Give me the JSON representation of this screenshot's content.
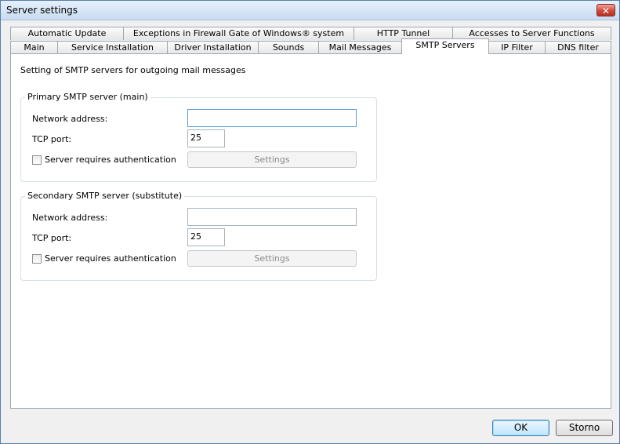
{
  "window": {
    "title": "Server settings",
    "close_glyph": "✕"
  },
  "tabs_row1": [
    {
      "label": "Automatic Update"
    },
    {
      "label": "Exceptions in Firewall Gate of Windows® system"
    },
    {
      "label": "HTTP Tunnel"
    },
    {
      "label": "Accesses to Server Functions"
    }
  ],
  "tabs_row2": [
    {
      "label": "Main"
    },
    {
      "label": "Service Installation"
    },
    {
      "label": "Driver Installation"
    },
    {
      "label": "Sounds"
    },
    {
      "label": "Mail Messages"
    },
    {
      "label": "SMTP Servers",
      "selected": true
    },
    {
      "label": "IP Filter"
    },
    {
      "label": "DNS filter"
    }
  ],
  "panel": {
    "description": "Setting of SMTP servers for outgoing mail messages",
    "primary": {
      "legend": "Primary SMTP server (main)",
      "address_label": "Network address:",
      "address_value": "",
      "port_label": "TCP port:",
      "port_value": "25",
      "auth_label": "Server requires authentication",
      "auth_checked": false,
      "settings_label": "Settings"
    },
    "secondary": {
      "legend": "Secondary SMTP server (substitute)",
      "address_label": "Network address:",
      "address_value": "",
      "port_label": "TCP port:",
      "port_value": "25",
      "auth_label": "Server requires authentication",
      "auth_checked": false,
      "settings_label": "Settings"
    }
  },
  "buttons": {
    "ok": "OK",
    "cancel": "Storno"
  },
  "colors": {
    "title_bar": "#c9dcf2",
    "close_button": "#cf4a3b",
    "focus_border": "#5c9fd4",
    "default_button": "#bee6fd"
  }
}
